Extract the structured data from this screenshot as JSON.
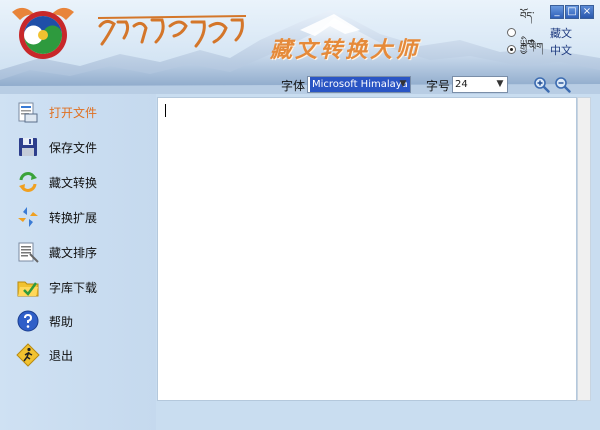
{
  "app": {
    "title": "藏文转换大师",
    "colors": {
      "accent": "#e07020",
      "title_orange": "#e58a3a",
      "panel_blue": "#c9ddf0"
    }
  },
  "window_controls": {
    "minimize": "_",
    "maximize": "□",
    "close": "×"
  },
  "language": {
    "options": [
      {
        "tibetan": "བོད་ཡིག",
        "label": "藏文",
        "selected": false
      },
      {
        "tibetan": "རྒྱ་ཡིག",
        "label": "中文",
        "selected": true
      }
    ]
  },
  "toolbar": {
    "font_label": "字体",
    "font_value": "Microsoft Himalaya",
    "size_label": "字号",
    "size_value": "24",
    "zoom_in_icon": "zoom-in-icon",
    "zoom_out_icon": "zoom-out-icon"
  },
  "sidebar": {
    "items": [
      {
        "label": "打开文件",
        "icon": "open-file-icon",
        "active": true
      },
      {
        "label": "保存文件",
        "icon": "save-file-icon",
        "active": false
      },
      {
        "label": "藏文转换",
        "icon": "convert-icon",
        "active": false
      },
      {
        "label": "转换扩展",
        "icon": "extend-icon",
        "active": false
      },
      {
        "label": "藏文排序",
        "icon": "sort-icon",
        "active": false
      },
      {
        "label": "字库下载",
        "icon": "font-download-icon",
        "active": false
      },
      {
        "label": "帮助",
        "icon": "help-icon",
        "active": false
      },
      {
        "label": "退出",
        "icon": "exit-icon",
        "active": false
      }
    ]
  },
  "editor": {
    "content": ""
  }
}
